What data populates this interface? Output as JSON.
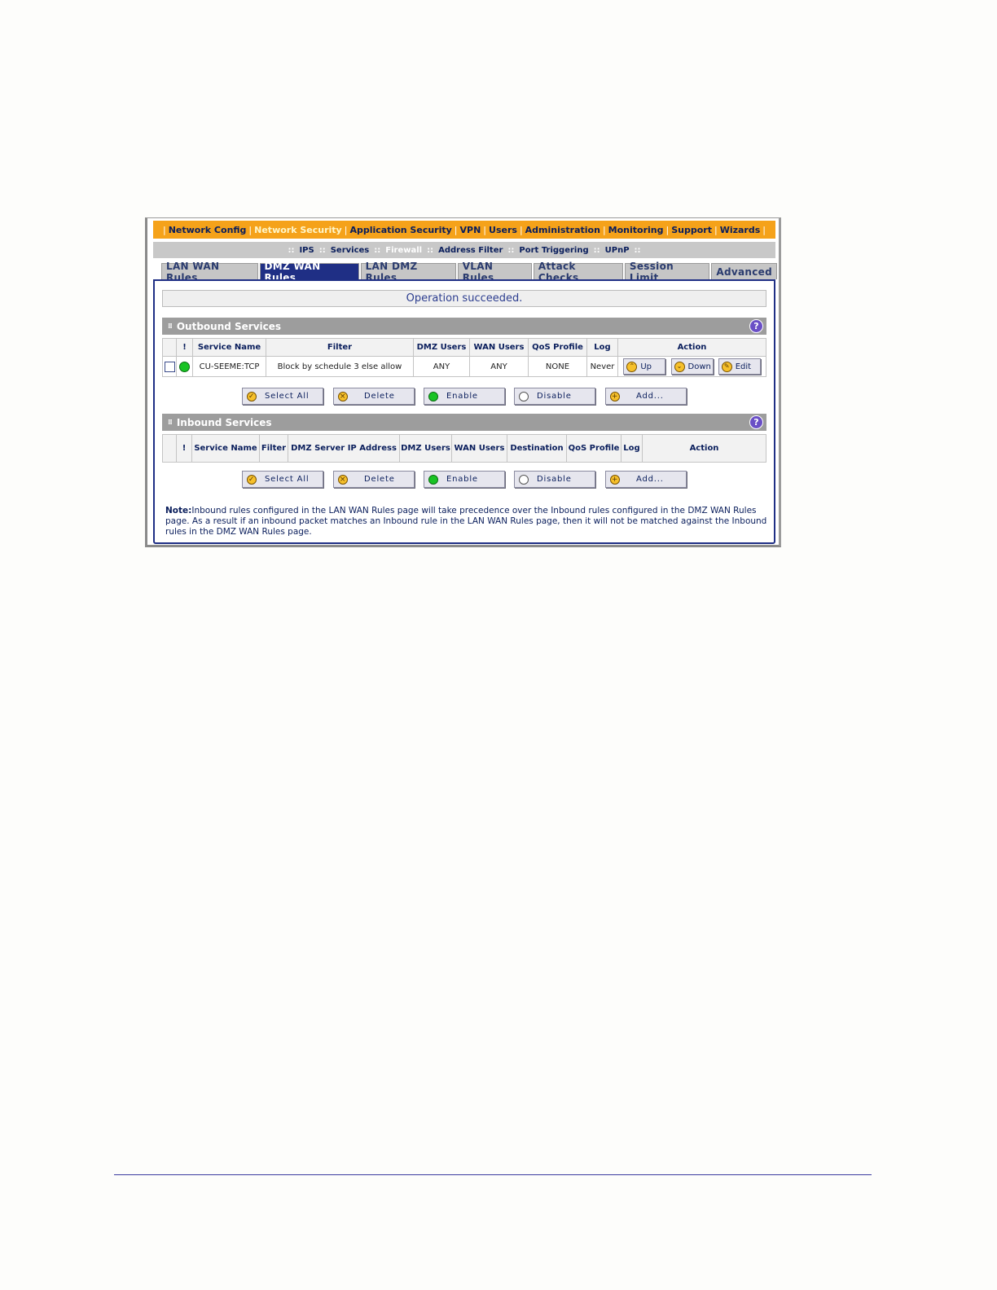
{
  "main_nav": [
    {
      "label": "Network Config",
      "active": false
    },
    {
      "label": "Network Security",
      "active": true
    },
    {
      "label": "Application Security",
      "active": false
    },
    {
      "label": "VPN",
      "active": false
    },
    {
      "label": "Users",
      "active": false
    },
    {
      "label": "Administration",
      "active": false
    },
    {
      "label": "Monitoring",
      "active": false
    },
    {
      "label": "Support",
      "active": false
    },
    {
      "label": "Wizards",
      "active": false
    }
  ],
  "sub_nav": [
    {
      "label": "IPS",
      "active": false
    },
    {
      "label": "Services",
      "active": false
    },
    {
      "label": "Firewall",
      "active": true
    },
    {
      "label": "Address Filter",
      "active": false
    },
    {
      "label": "Port Triggering",
      "active": false
    },
    {
      "label": "UPnP",
      "active": false
    }
  ],
  "tabs": [
    {
      "label": "LAN WAN Rules",
      "active": false
    },
    {
      "label": "DMZ WAN Rules",
      "active": true
    },
    {
      "label": "LAN DMZ Rules",
      "active": false
    },
    {
      "label": "VLAN Rules",
      "active": false
    },
    {
      "label": "Attack Checks",
      "active": false
    },
    {
      "label": "Session Limit",
      "active": false
    },
    {
      "label": "Advanced",
      "active": false
    }
  ],
  "status_message": "Operation succeeded.",
  "outbound": {
    "title": "Outbound Services",
    "columns": [
      "!",
      "Service Name",
      "Filter",
      "DMZ Users",
      "WAN Users",
      "QoS Profile",
      "Log",
      "Action"
    ],
    "rows": [
      {
        "service": "CU-SEEME:TCP",
        "filter": "Block by schedule 3 else allow",
        "dmz_users": "ANY",
        "wan_users": "ANY",
        "qos": "NONE",
        "log": "Never"
      }
    ],
    "row_actions": {
      "up": "Up",
      "down": "Down",
      "edit": "Edit"
    }
  },
  "inbound": {
    "title": "Inbound Services",
    "columns": [
      "!",
      "Service Name",
      "Filter",
      "DMZ Server IP Address",
      "DMZ Users",
      "WAN Users",
      "Destination",
      "QoS Profile",
      "Log",
      "Action"
    ]
  },
  "buttons": {
    "select_all": "Select All",
    "delete": "Delete",
    "enable": "Enable",
    "disable": "Disable",
    "add": "Add..."
  },
  "note": {
    "label": "Note:",
    "text": "Inbound rules configured in the LAN WAN Rules page will take precedence over the Inbound rules configured in the DMZ WAN Rules page. As a result if an inbound packet matches an Inbound rule in the LAN WAN Rules page, then it will not be matched against the Inbound rules in the DMZ WAN Rules page."
  },
  "help_icon_label": "?"
}
